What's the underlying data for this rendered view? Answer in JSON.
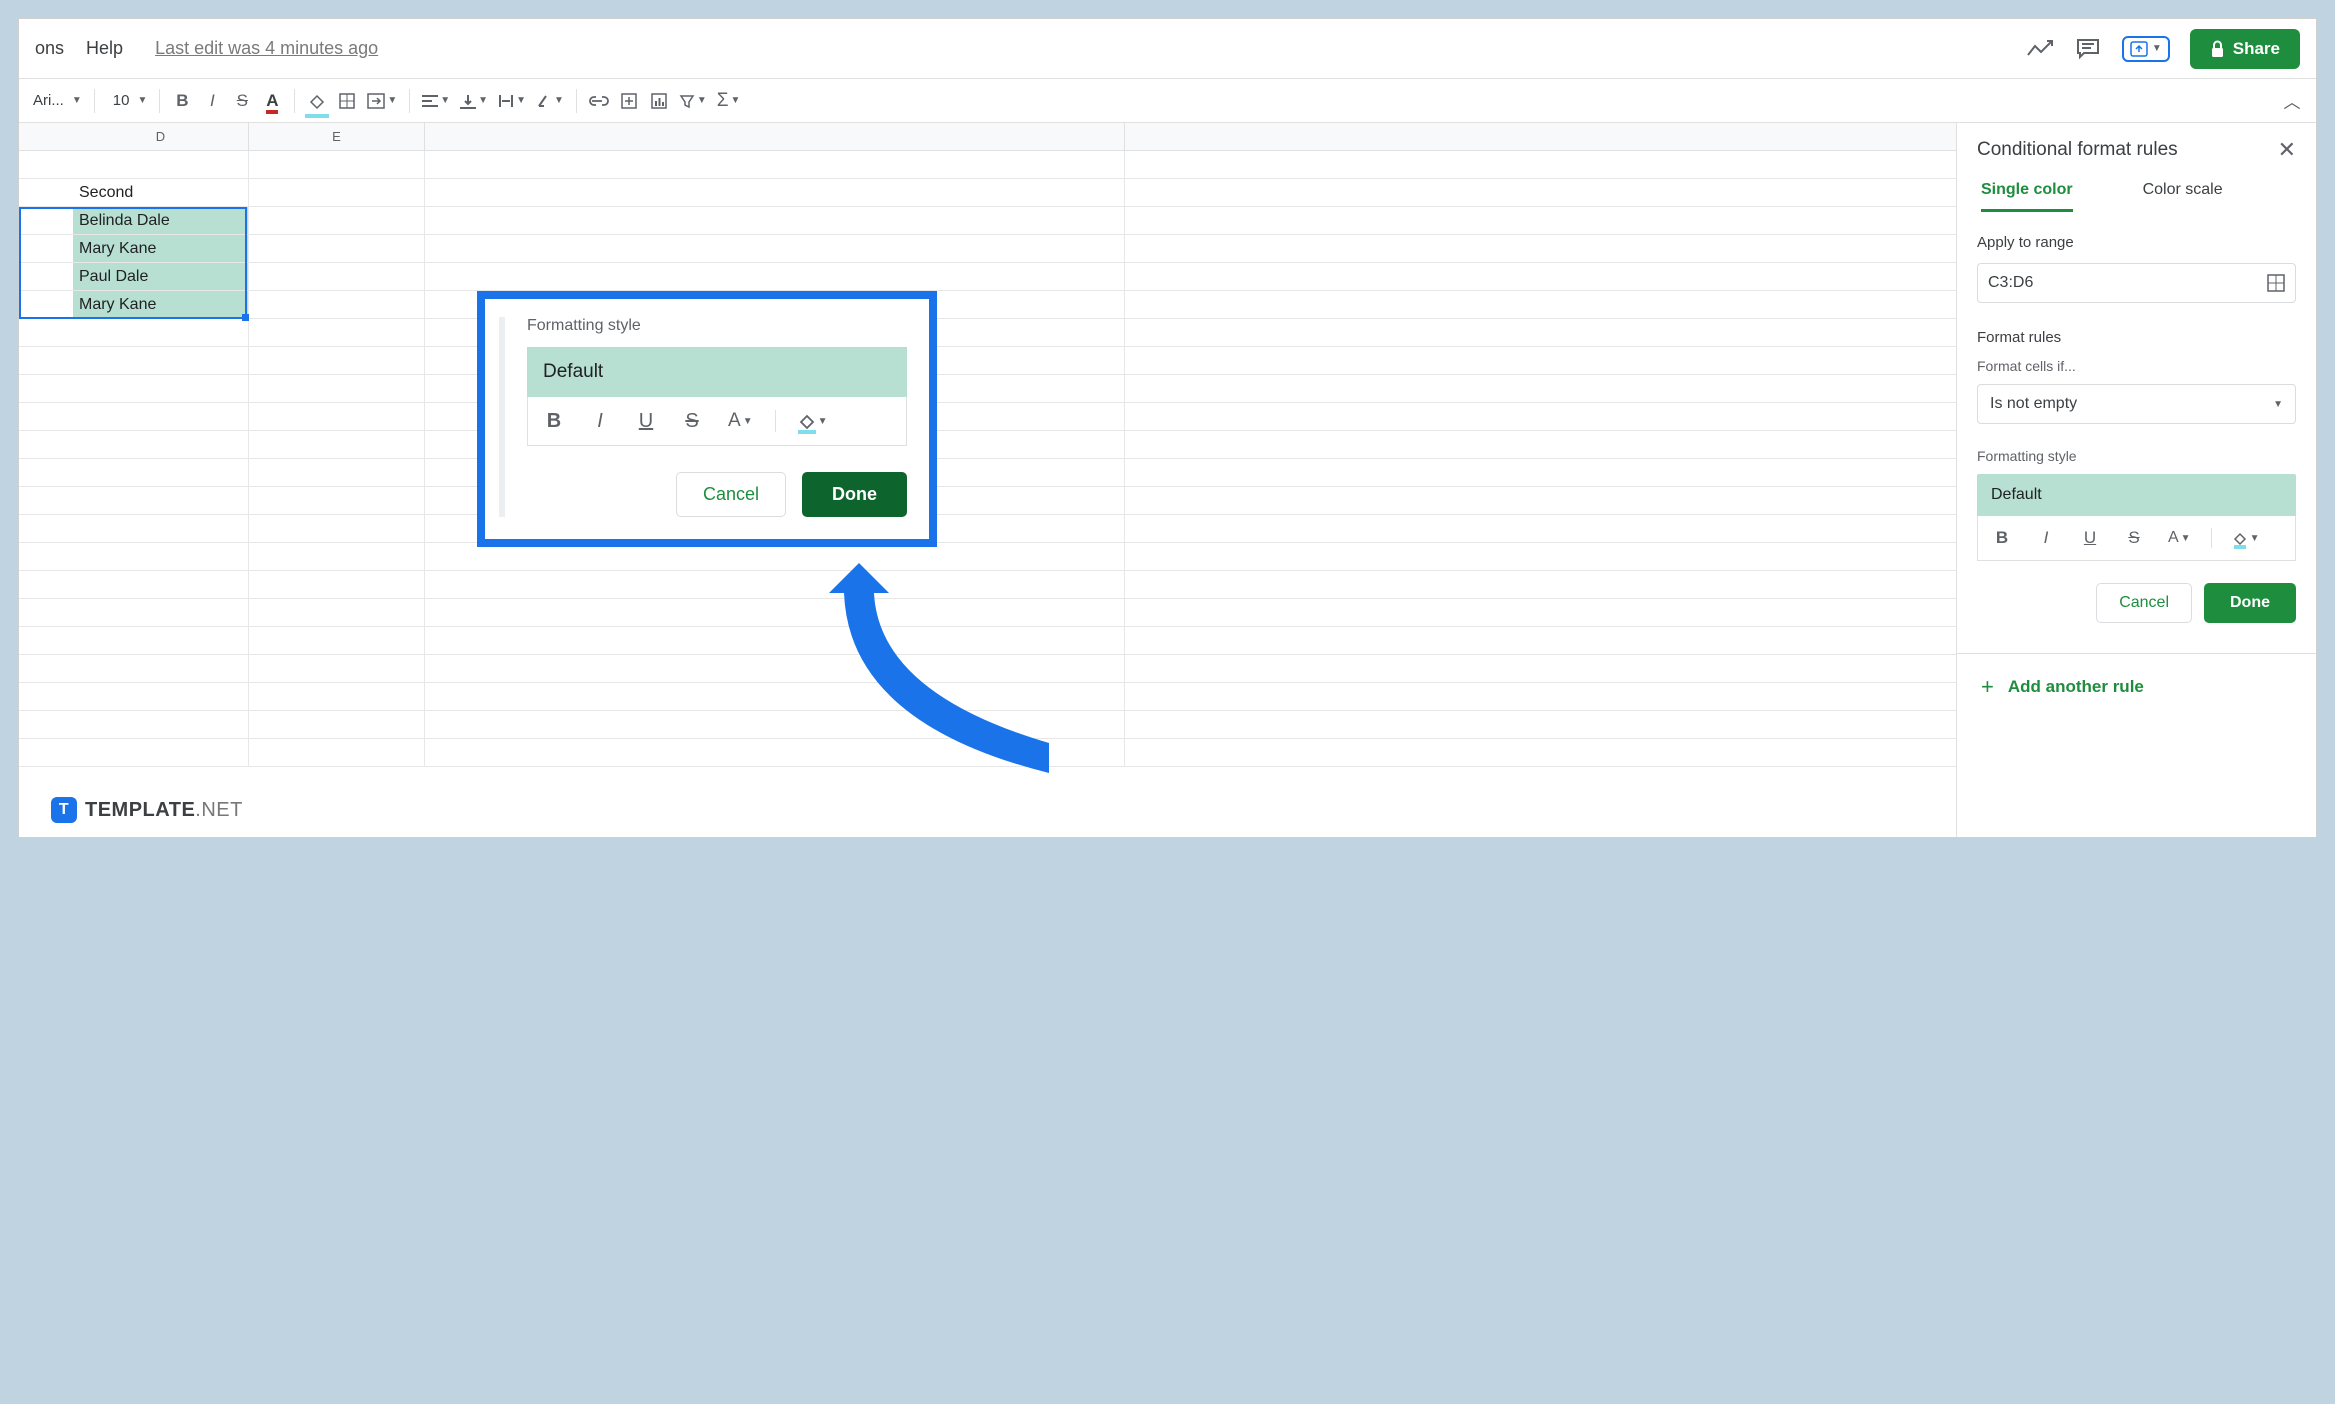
{
  "menu": {
    "ons": "ons",
    "help": "Help",
    "last_edit": "Last edit was 4 minutes ago"
  },
  "share_label": "Share",
  "toolbar": {
    "font": "Ari...",
    "size": "10"
  },
  "columns": [
    "D",
    "E"
  ],
  "cells": {
    "d1": "Second",
    "d2": "Belinda Dale",
    "d3": "Mary Kane",
    "d4": "Paul Dale",
    "d5": "Mary Kane"
  },
  "callout": {
    "label": "Formatting style",
    "preview": "Default",
    "cancel": "Cancel",
    "done": "Done"
  },
  "sidebar": {
    "title": "Conditional format rules",
    "tab_single": "Single color",
    "tab_scale": "Color scale",
    "apply_label": "Apply to range",
    "range": "C3:D6",
    "format_rules": "Format rules",
    "cells_if": "Format cells if...",
    "condition": "Is not empty",
    "style_label": "Formatting style",
    "style_value": "Default",
    "cancel": "Cancel",
    "done": "Done",
    "add_rule": "Add another rule"
  },
  "watermark": {
    "brand": "TEMPLATE",
    "suffix": ".NET"
  }
}
